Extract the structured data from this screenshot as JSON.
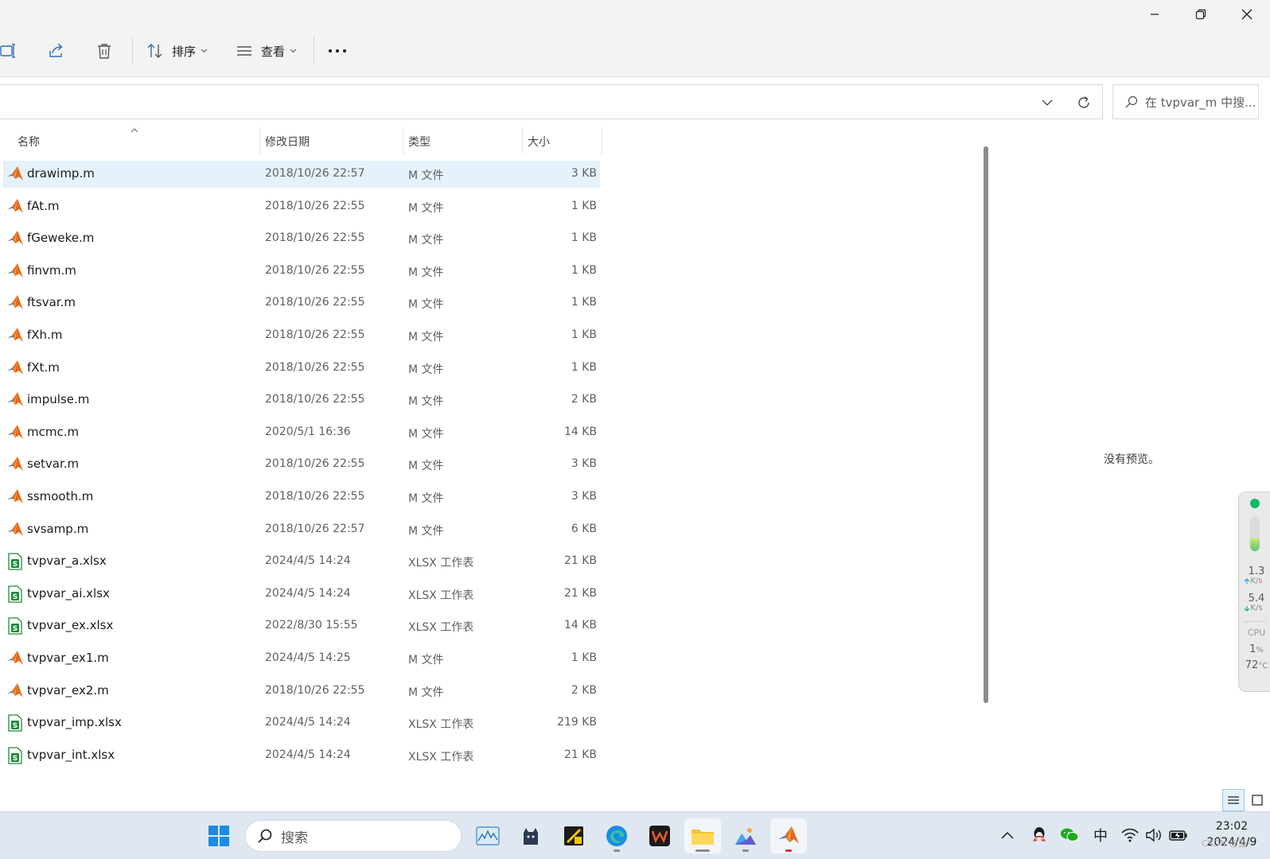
{
  "toolbar": {
    "sort_label": "排序",
    "view_label": "查看"
  },
  "search": {
    "placeholder": "在 tvpvar_m 中搜..."
  },
  "columns": {
    "name": "名称",
    "date": "修改日期",
    "type": "类型",
    "size": "大小"
  },
  "files": [
    {
      "name": "drawimp.m",
      "date": "2018/10/26 22:57",
      "type": "M 文件",
      "size": "3 KB",
      "icon": "matlab-icon"
    },
    {
      "name": "fAt.m",
      "date": "2018/10/26 22:55",
      "type": "M 文件",
      "size": "1 KB",
      "icon": "matlab-icon"
    },
    {
      "name": "fGeweke.m",
      "date": "2018/10/26 22:55",
      "type": "M 文件",
      "size": "1 KB",
      "icon": "matlab-icon"
    },
    {
      "name": "finvm.m",
      "date": "2018/10/26 22:55",
      "type": "M 文件",
      "size": "1 KB",
      "icon": "matlab-icon"
    },
    {
      "name": "ftsvar.m",
      "date": "2018/10/26 22:55",
      "type": "M 文件",
      "size": "1 KB",
      "icon": "matlab-icon"
    },
    {
      "name": "fXh.m",
      "date": "2018/10/26 22:55",
      "type": "M 文件",
      "size": "1 KB",
      "icon": "matlab-icon"
    },
    {
      "name": "fXt.m",
      "date": "2018/10/26 22:55",
      "type": "M 文件",
      "size": "1 KB",
      "icon": "matlab-icon"
    },
    {
      "name": "impulse.m",
      "date": "2018/10/26 22:55",
      "type": "M 文件",
      "size": "2 KB",
      "icon": "matlab-icon"
    },
    {
      "name": "mcmc.m",
      "date": "2020/5/1 16:36",
      "type": "M 文件",
      "size": "14 KB",
      "icon": "matlab-icon"
    },
    {
      "name": "setvar.m",
      "date": "2018/10/26 22:55",
      "type": "M 文件",
      "size": "3 KB",
      "icon": "matlab-icon"
    },
    {
      "name": "ssmooth.m",
      "date": "2018/10/26 22:55",
      "type": "M 文件",
      "size": "3 KB",
      "icon": "matlab-icon"
    },
    {
      "name": "svsamp.m",
      "date": "2018/10/26 22:57",
      "type": "M 文件",
      "size": "6 KB",
      "icon": "matlab-icon"
    },
    {
      "name": "tvpvar_a.xlsx",
      "date": "2024/4/5 14:24",
      "type": "XLSX 工作表",
      "size": "21 KB",
      "icon": "spreadsheet-icon"
    },
    {
      "name": "tvpvar_ai.xlsx",
      "date": "2024/4/5 14:24",
      "type": "XLSX 工作表",
      "size": "21 KB",
      "icon": "spreadsheet-icon"
    },
    {
      "name": "tvpvar_ex.xlsx",
      "date": "2022/8/30 15:55",
      "type": "XLSX 工作表",
      "size": "14 KB",
      "icon": "spreadsheet-icon"
    },
    {
      "name": "tvpvar_ex1.m",
      "date": "2024/4/5 14:25",
      "type": "M 文件",
      "size": "1 KB",
      "icon": "matlab-icon"
    },
    {
      "name": "tvpvar_ex2.m",
      "date": "2018/10/26 22:55",
      "type": "M 文件",
      "size": "2 KB",
      "icon": "matlab-icon"
    },
    {
      "name": "tvpvar_imp.xlsx",
      "date": "2024/4/5 14:24",
      "type": "XLSX 工作表",
      "size": "219 KB",
      "icon": "spreadsheet-icon"
    },
    {
      "name": "tvpvar_int.xlsx",
      "date": "2024/4/5 14:24",
      "type": "XLSX 工作表",
      "size": "21 KB",
      "icon": "spreadsheet-icon"
    }
  ],
  "preview": {
    "empty_text": "没有预览。"
  },
  "monitor": {
    "upload_value": "1.3",
    "upload_unit": "K/s",
    "download_value": "5.4",
    "download_unit": "K/s",
    "cpu_label": "CPU",
    "cpu_value": "1",
    "cpu_unit": "%",
    "temp_value": "72",
    "temp_unit": "°C"
  },
  "taskbar": {
    "search_placeholder": "搜索",
    "ime_label": "中",
    "time": "23:02",
    "date": "2024/4/9",
    "watermark": "CSDN @蓝~"
  },
  "colors": {
    "selection": "#e5f1fb",
    "taskbar": "#dfe8f1",
    "matlab_orange": "#e16c1c",
    "excel_green": "#1f8a3b"
  }
}
